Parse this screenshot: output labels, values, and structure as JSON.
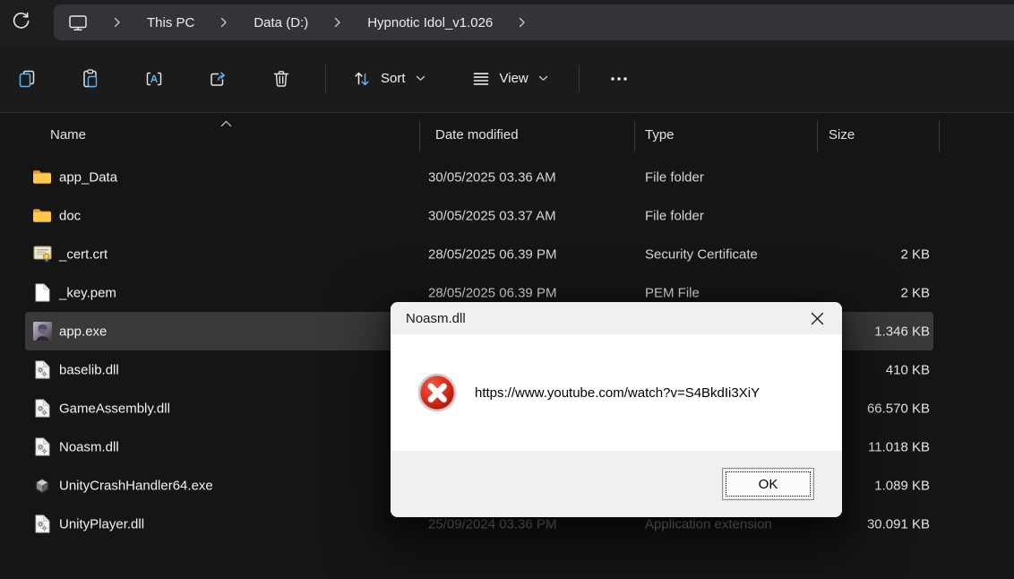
{
  "breadcrumb": {
    "refresh_icon": "refresh-icon",
    "location_icon": "this-pc-icon",
    "items": [
      "This PC",
      "Data (D:)",
      "Hypnotic Idol_v1.026"
    ]
  },
  "toolbar": {
    "buttons": [
      {
        "name": "copy-button",
        "icon": "copy-icon"
      },
      {
        "name": "paste-button",
        "icon": "paste-icon"
      },
      {
        "name": "rename-button",
        "icon": "rename-icon"
      },
      {
        "name": "share-button",
        "icon": "share-icon"
      },
      {
        "name": "delete-button",
        "icon": "delete-icon"
      }
    ],
    "sort_label": "Sort",
    "view_label": "View",
    "sort_icon": "sort-icon",
    "view_icon": "view-icon",
    "more_icon": "more-options-icon"
  },
  "columns": {
    "name": "Name",
    "date_modified": "Date modified",
    "type": "Type",
    "size": "Size",
    "sort_indicator_icon": "sort-ascending-icon"
  },
  "files": [
    {
      "name": "app_Data",
      "icon": "folder-icon",
      "date": "30/05/2025 03.36 AM",
      "type": "File folder",
      "size": "",
      "selected": false,
      "dimmed": false
    },
    {
      "name": "doc",
      "icon": "folder-icon",
      "date": "30/05/2025 03.37 AM",
      "type": "File folder",
      "size": "",
      "selected": false,
      "dimmed": false
    },
    {
      "name": "_cert.crt",
      "icon": "certificate-icon",
      "date": "28/05/2025 06.39 PM",
      "type": "Security Certificate",
      "size": "2 KB",
      "selected": false,
      "dimmed": false
    },
    {
      "name": "_key.pem",
      "icon": "pem-file-icon",
      "date": "28/05/2025 06.39 PM",
      "type": "PEM File",
      "size": "2 KB",
      "selected": false,
      "dimmed": false
    },
    {
      "name": "app.exe",
      "icon": "app-exe-icon",
      "date": "",
      "type": "",
      "size": "1.346 KB",
      "selected": true,
      "dimmed": false
    },
    {
      "name": "baselib.dll",
      "icon": "dll-icon",
      "date": "",
      "type": "",
      "size": "410 KB",
      "selected": false,
      "dimmed": false
    },
    {
      "name": "GameAssembly.dll",
      "icon": "dll-icon",
      "date": "",
      "type": "",
      "size": "66.570 KB",
      "selected": false,
      "dimmed": false
    },
    {
      "name": "Noasm.dll",
      "icon": "dll-icon",
      "date": "",
      "type": "",
      "size": "11.018 KB",
      "selected": false,
      "dimmed": false
    },
    {
      "name": "UnityCrashHandler64.exe",
      "icon": "unity-icon",
      "date": "",
      "type": "",
      "size": "1.089 KB",
      "selected": false,
      "dimmed": false
    },
    {
      "name": "UnityPlayer.dll",
      "icon": "dll-icon",
      "date": "25/09/2024 03.36 PM",
      "type": "Application extension",
      "size": "30.091 KB",
      "selected": false,
      "dimmed": true
    }
  ],
  "dialog": {
    "title": "Noasm.dll",
    "message": "https://www.youtube.com/watch?v=S4BkdIi3XiY",
    "ok_label": "OK",
    "close_icon": "close-icon",
    "error_icon": "error-icon"
  },
  "colors": {
    "accent_blue": "#5ab2f5",
    "selection": "#393939",
    "folder_yellow": "#ffc84a",
    "error_red": "#d42a1c",
    "dialog_footer": "#f0f0f0"
  }
}
